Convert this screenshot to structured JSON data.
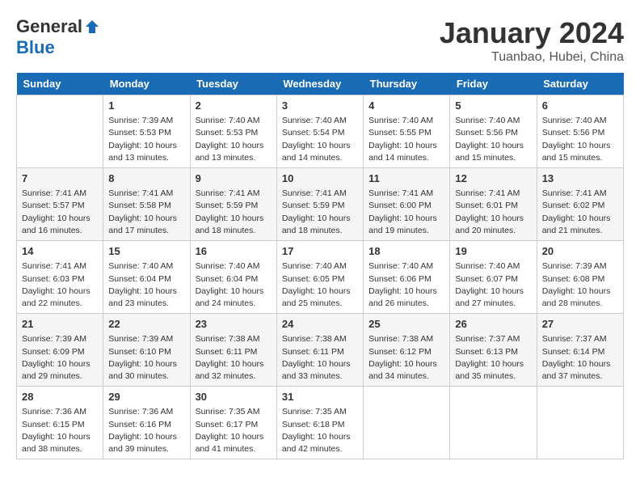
{
  "header": {
    "logo_general": "General",
    "logo_blue": "Blue",
    "month_year": "January 2024",
    "location": "Tuanbao, Hubei, China"
  },
  "days_of_week": [
    "Sunday",
    "Monday",
    "Tuesday",
    "Wednesday",
    "Thursday",
    "Friday",
    "Saturday"
  ],
  "weeks": [
    [
      {
        "day": "",
        "sunrise": "",
        "sunset": "",
        "daylight": ""
      },
      {
        "day": "1",
        "sunrise": "Sunrise: 7:39 AM",
        "sunset": "Sunset: 5:53 PM",
        "daylight": "Daylight: 10 hours and 13 minutes."
      },
      {
        "day": "2",
        "sunrise": "Sunrise: 7:40 AM",
        "sunset": "Sunset: 5:53 PM",
        "daylight": "Daylight: 10 hours and 13 minutes."
      },
      {
        "day": "3",
        "sunrise": "Sunrise: 7:40 AM",
        "sunset": "Sunset: 5:54 PM",
        "daylight": "Daylight: 10 hours and 14 minutes."
      },
      {
        "day": "4",
        "sunrise": "Sunrise: 7:40 AM",
        "sunset": "Sunset: 5:55 PM",
        "daylight": "Daylight: 10 hours and 14 minutes."
      },
      {
        "day": "5",
        "sunrise": "Sunrise: 7:40 AM",
        "sunset": "Sunset: 5:56 PM",
        "daylight": "Daylight: 10 hours and 15 minutes."
      },
      {
        "day": "6",
        "sunrise": "Sunrise: 7:40 AM",
        "sunset": "Sunset: 5:56 PM",
        "daylight": "Daylight: 10 hours and 15 minutes."
      }
    ],
    [
      {
        "day": "7",
        "sunrise": "Sunrise: 7:41 AM",
        "sunset": "Sunset: 5:57 PM",
        "daylight": "Daylight: 10 hours and 16 minutes."
      },
      {
        "day": "8",
        "sunrise": "Sunrise: 7:41 AM",
        "sunset": "Sunset: 5:58 PM",
        "daylight": "Daylight: 10 hours and 17 minutes."
      },
      {
        "day": "9",
        "sunrise": "Sunrise: 7:41 AM",
        "sunset": "Sunset: 5:59 PM",
        "daylight": "Daylight: 10 hours and 18 minutes."
      },
      {
        "day": "10",
        "sunrise": "Sunrise: 7:41 AM",
        "sunset": "Sunset: 5:59 PM",
        "daylight": "Daylight: 10 hours and 18 minutes."
      },
      {
        "day": "11",
        "sunrise": "Sunrise: 7:41 AM",
        "sunset": "Sunset: 6:00 PM",
        "daylight": "Daylight: 10 hours and 19 minutes."
      },
      {
        "day": "12",
        "sunrise": "Sunrise: 7:41 AM",
        "sunset": "Sunset: 6:01 PM",
        "daylight": "Daylight: 10 hours and 20 minutes."
      },
      {
        "day": "13",
        "sunrise": "Sunrise: 7:41 AM",
        "sunset": "Sunset: 6:02 PM",
        "daylight": "Daylight: 10 hours and 21 minutes."
      }
    ],
    [
      {
        "day": "14",
        "sunrise": "Sunrise: 7:41 AM",
        "sunset": "Sunset: 6:03 PM",
        "daylight": "Daylight: 10 hours and 22 minutes."
      },
      {
        "day": "15",
        "sunrise": "Sunrise: 7:40 AM",
        "sunset": "Sunset: 6:04 PM",
        "daylight": "Daylight: 10 hours and 23 minutes."
      },
      {
        "day": "16",
        "sunrise": "Sunrise: 7:40 AM",
        "sunset": "Sunset: 6:04 PM",
        "daylight": "Daylight: 10 hours and 24 minutes."
      },
      {
        "day": "17",
        "sunrise": "Sunrise: 7:40 AM",
        "sunset": "Sunset: 6:05 PM",
        "daylight": "Daylight: 10 hours and 25 minutes."
      },
      {
        "day": "18",
        "sunrise": "Sunrise: 7:40 AM",
        "sunset": "Sunset: 6:06 PM",
        "daylight": "Daylight: 10 hours and 26 minutes."
      },
      {
        "day": "19",
        "sunrise": "Sunrise: 7:40 AM",
        "sunset": "Sunset: 6:07 PM",
        "daylight": "Daylight: 10 hours and 27 minutes."
      },
      {
        "day": "20",
        "sunrise": "Sunrise: 7:39 AM",
        "sunset": "Sunset: 6:08 PM",
        "daylight": "Daylight: 10 hours and 28 minutes."
      }
    ],
    [
      {
        "day": "21",
        "sunrise": "Sunrise: 7:39 AM",
        "sunset": "Sunset: 6:09 PM",
        "daylight": "Daylight: 10 hours and 29 minutes."
      },
      {
        "day": "22",
        "sunrise": "Sunrise: 7:39 AM",
        "sunset": "Sunset: 6:10 PM",
        "daylight": "Daylight: 10 hours and 30 minutes."
      },
      {
        "day": "23",
        "sunrise": "Sunrise: 7:38 AM",
        "sunset": "Sunset: 6:11 PM",
        "daylight": "Daylight: 10 hours and 32 minutes."
      },
      {
        "day": "24",
        "sunrise": "Sunrise: 7:38 AM",
        "sunset": "Sunset: 6:11 PM",
        "daylight": "Daylight: 10 hours and 33 minutes."
      },
      {
        "day": "25",
        "sunrise": "Sunrise: 7:38 AM",
        "sunset": "Sunset: 6:12 PM",
        "daylight": "Daylight: 10 hours and 34 minutes."
      },
      {
        "day": "26",
        "sunrise": "Sunrise: 7:37 AM",
        "sunset": "Sunset: 6:13 PM",
        "daylight": "Daylight: 10 hours and 35 minutes."
      },
      {
        "day": "27",
        "sunrise": "Sunrise: 7:37 AM",
        "sunset": "Sunset: 6:14 PM",
        "daylight": "Daylight: 10 hours and 37 minutes."
      }
    ],
    [
      {
        "day": "28",
        "sunrise": "Sunrise: 7:36 AM",
        "sunset": "Sunset: 6:15 PM",
        "daylight": "Daylight: 10 hours and 38 minutes."
      },
      {
        "day": "29",
        "sunrise": "Sunrise: 7:36 AM",
        "sunset": "Sunset: 6:16 PM",
        "daylight": "Daylight: 10 hours and 39 minutes."
      },
      {
        "day": "30",
        "sunrise": "Sunrise: 7:35 AM",
        "sunset": "Sunset: 6:17 PM",
        "daylight": "Daylight: 10 hours and 41 minutes."
      },
      {
        "day": "31",
        "sunrise": "Sunrise: 7:35 AM",
        "sunset": "Sunset: 6:18 PM",
        "daylight": "Daylight: 10 hours and 42 minutes."
      },
      {
        "day": "",
        "sunrise": "",
        "sunset": "",
        "daylight": ""
      },
      {
        "day": "",
        "sunrise": "",
        "sunset": "",
        "daylight": ""
      },
      {
        "day": "",
        "sunrise": "",
        "sunset": "",
        "daylight": ""
      }
    ]
  ]
}
